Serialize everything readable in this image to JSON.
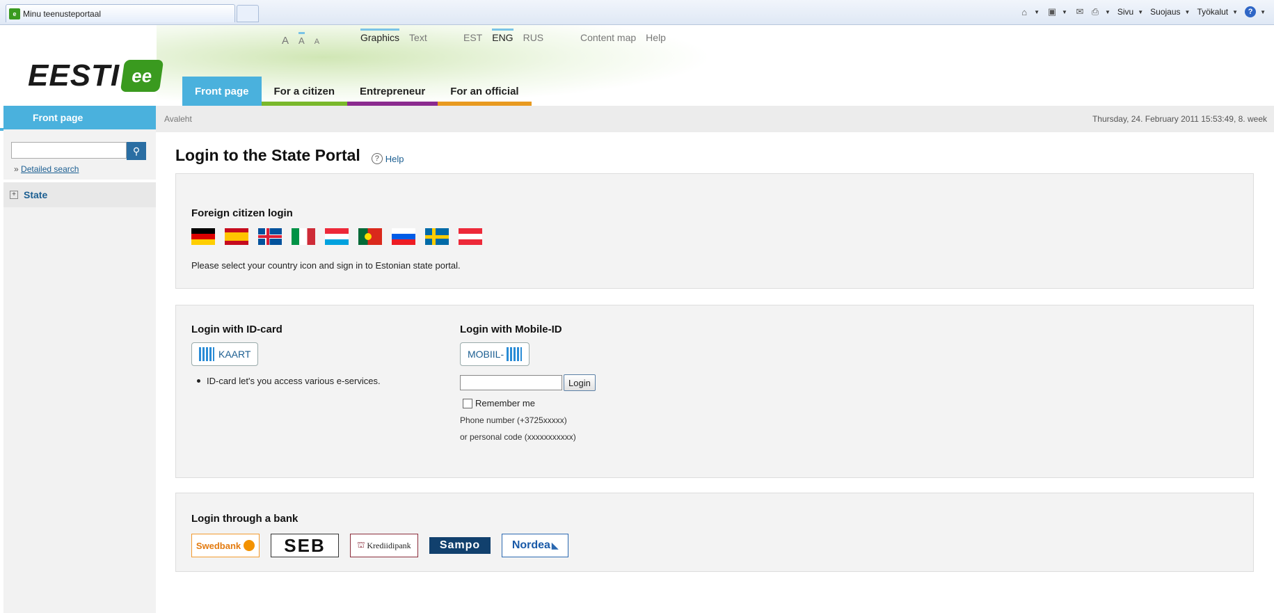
{
  "browser": {
    "tab_title": "Minu teenusteportaal",
    "favicon_text": "e",
    "commands": [
      "Sivu",
      "Suojaus",
      "Työkalut"
    ]
  },
  "header": {
    "logo_text": "EESTI",
    "logo_badge": "ee",
    "font_sizes": [
      "A",
      "A",
      "A"
    ],
    "view_links": [
      "Graphics",
      "Text"
    ],
    "languages": [
      "EST",
      "ENG",
      "RUS"
    ],
    "active_language": "ENG",
    "util_links": [
      "Content map",
      "Help"
    ],
    "nav": [
      {
        "label": "Front page",
        "color": "#4ab1dd",
        "active": true
      },
      {
        "label": "For a citizen",
        "color": "#7ab82b",
        "active": false
      },
      {
        "label": "Entrepreneur",
        "color": "#8b2a8f",
        "active": false
      },
      {
        "label": "For an official",
        "color": "#e89a20",
        "active": false
      }
    ]
  },
  "sidebar": {
    "heading": "Front page",
    "search_placeholder": "",
    "detailed_search_prefix": "»",
    "detailed_search": "Detailed search",
    "items": [
      {
        "label": "State",
        "expander": "+"
      }
    ]
  },
  "crumbbar": {
    "breadcrumb": "Avaleht",
    "datetime": "Thursday, 24. February 2011 15:53:49, 8. week"
  },
  "main": {
    "title": "Login to the State Portal",
    "help_label": "Help",
    "foreign": {
      "heading": "Foreign citizen login",
      "flags": [
        "germany",
        "spain",
        "iceland",
        "italy",
        "luxembourg",
        "portugal",
        "slovenia",
        "sweden",
        "austria"
      ],
      "description": "Please select your country icon and sign in to Estonian state portal."
    },
    "idcard": {
      "heading": "Login with ID-card",
      "button": "KAART",
      "bullet": "ID-card let's you access various e-services."
    },
    "mobile": {
      "heading": "Login with Mobile-ID",
      "button": "MOBIIL-",
      "input_value": "",
      "login_button": "Login",
      "remember": "Remember me",
      "hint_phone": "Phone number (+3725xxxxx)",
      "hint_code": "or personal code (xxxxxxxxxxx)"
    },
    "bank": {
      "heading": "Login through a bank",
      "banks": [
        "Swedbank",
        "SEB",
        "Krediidipank",
        "Sampo",
        "Nordea"
      ]
    }
  }
}
